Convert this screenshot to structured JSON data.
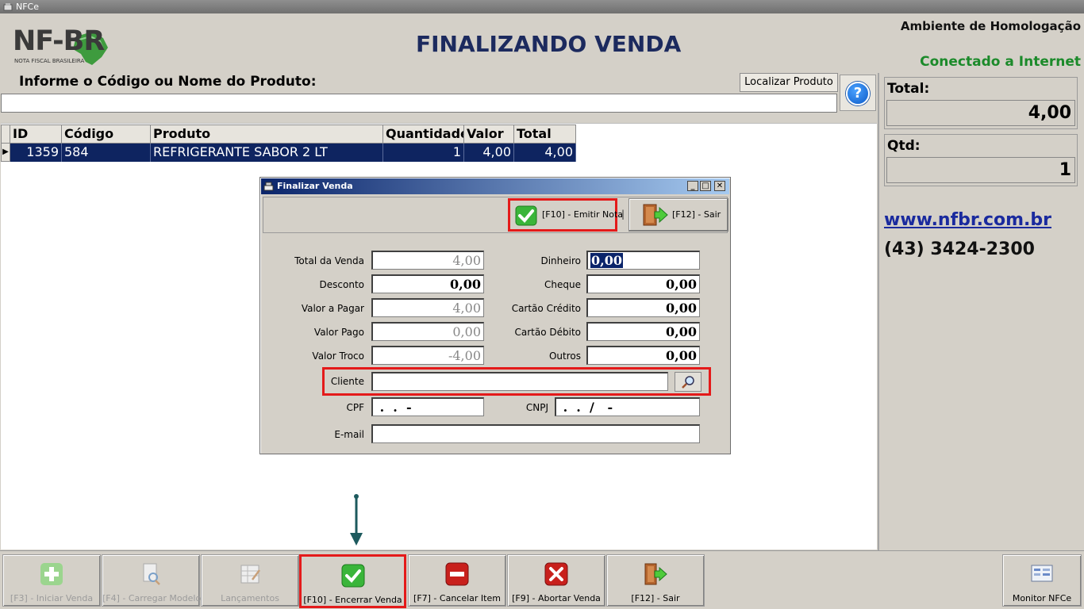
{
  "window": {
    "title": "NFCe"
  },
  "header": {
    "logo_text": "NF-BR",
    "logo_sub": "NOTA FISCAL BRASILEIRA",
    "page_title": "FINALIZANDO VENDA",
    "environment": "Ambiente de Homologação",
    "connection": "Conectado a Internet"
  },
  "search": {
    "label": "Informe o Código ou Nome do Produto:",
    "value": "",
    "find_button": "Localizar Produto",
    "help_symbol": "?"
  },
  "grid": {
    "columns": [
      "ID",
      "Código",
      "Produto",
      "Quantidade",
      "Valor",
      "Total"
    ],
    "rows": [
      {
        "id": "1359",
        "codigo": "584",
        "produto": "REFRIGERANTE SABOR 2 LT",
        "quantidade": "1",
        "valor": "4,00",
        "total": "4,00"
      }
    ],
    "row_marker": "▶"
  },
  "summary": {
    "total_label": "Total:",
    "total_value": "4,00",
    "qtd_label": "Qtd:",
    "qtd_value": "1",
    "website": "www.nfbr.com.br",
    "phone": "(43) 3424-2300"
  },
  "dialog": {
    "title": "Finalizar Venda",
    "emit_button": "[F10] - Emitir Nota",
    "separator": "|",
    "exit_button": "[F12] - Sair",
    "fields": {
      "total_venda": {
        "label": "Total da Venda",
        "value": "4,00"
      },
      "desconto": {
        "label": "Desconto",
        "value": "0,00"
      },
      "valor_pagar": {
        "label": "Valor a Pagar",
        "value": "4,00"
      },
      "valor_pago": {
        "label": "Valor Pago",
        "value": "0,00"
      },
      "valor_troco": {
        "label": "Valor Troco",
        "value": "-4,00"
      },
      "dinheiro": {
        "label": "Dinheiro",
        "value": "0,00"
      },
      "cheque": {
        "label": "Cheque",
        "value": "0,00"
      },
      "cartao_credito": {
        "label": "Cartão Crédito",
        "value": "0,00"
      },
      "cartao_debito": {
        "label": "Cartão Débito",
        "value": "0,00"
      },
      "outros": {
        "label": "Outros",
        "value": "0,00"
      },
      "cliente": {
        "label": "Cliente",
        "value": ""
      },
      "cpf": {
        "label": "CPF",
        "value": " .  .  -"
      },
      "cnpj": {
        "label": "CNPJ",
        "value": " .  .  /   -"
      },
      "email": {
        "label": "E-mail",
        "value": ""
      }
    }
  },
  "bottom_bar": {
    "buttons": [
      {
        "label": "[F3] - Iniciar Venda",
        "icon": "plus-icon",
        "enabled": false
      },
      {
        "label": "[F4] - Carregar Modelo",
        "icon": "document-search-icon",
        "enabled": false
      },
      {
        "label": "Lançamentos",
        "icon": "ledger-icon",
        "enabled": false
      },
      {
        "label": "[F10] - Encerrar Venda",
        "icon": "check-icon",
        "enabled": true
      },
      {
        "label": "[F7] - Cancelar Item",
        "icon": "minus-icon",
        "enabled": true
      },
      {
        "label": "[F9] - Abortar Venda",
        "icon": "x-icon",
        "enabled": true
      },
      {
        "label": "[F12] - Sair",
        "icon": "exit-door-icon",
        "enabled": true
      },
      {
        "label": "Monitor NFCe",
        "icon": "monitor-icon",
        "enabled": true
      }
    ]
  },
  "colors": {
    "selection": "#0e2460",
    "title_blue": "#1c2a5e",
    "connected_green": "#1b8a2a",
    "highlight_red": "#e41a1a",
    "link_blue": "#1a2a9e"
  }
}
